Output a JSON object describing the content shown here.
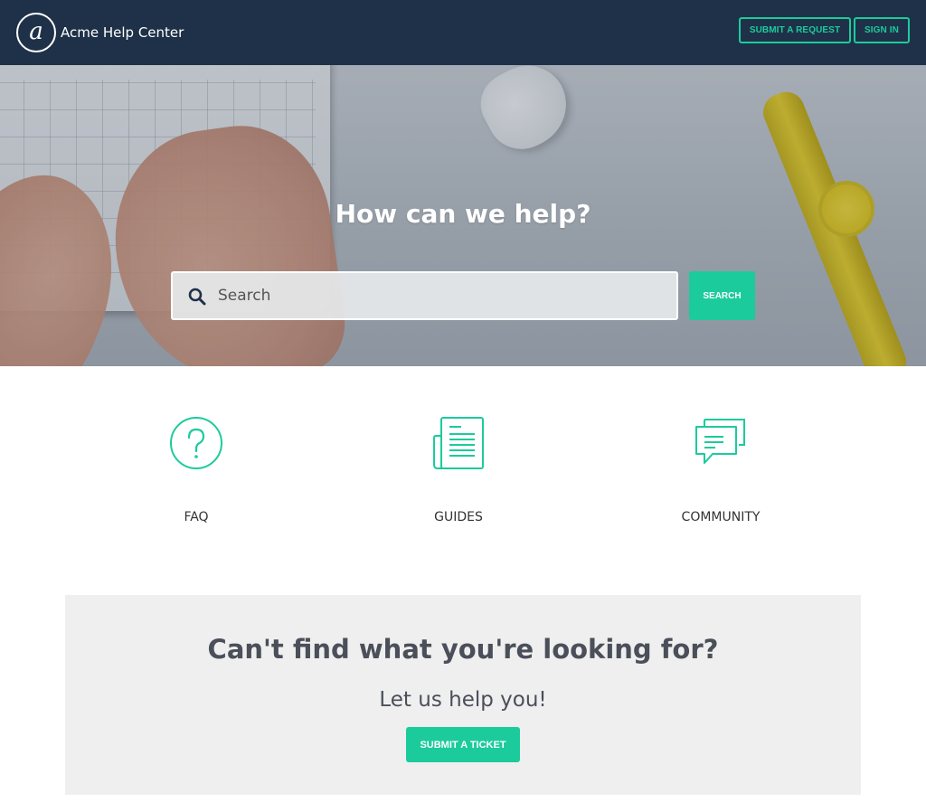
{
  "header": {
    "logo_glyph": "a",
    "brand": "Acme Help Center",
    "submit_request_label": "SUBMIT A REQUEST",
    "sign_in_label": "SIGN IN"
  },
  "hero": {
    "title": "How can we help?",
    "search_placeholder": "Search",
    "search_button_label": "SEARCH"
  },
  "categories": [
    {
      "label": "FAQ",
      "icon": "question-circle-icon"
    },
    {
      "label": "GUIDES",
      "icon": "document-icon"
    },
    {
      "label": "COMMUNITY",
      "icon": "chat-bubbles-icon"
    }
  ],
  "callout": {
    "title": "Can't find what you're looking for?",
    "subtitle": "Let us help you!",
    "button_label": "SUBMIT A TICKET"
  },
  "colors": {
    "header_bg": "#1f3149",
    "accent": "#1ccb9c",
    "callout_bg": "#efefef"
  }
}
